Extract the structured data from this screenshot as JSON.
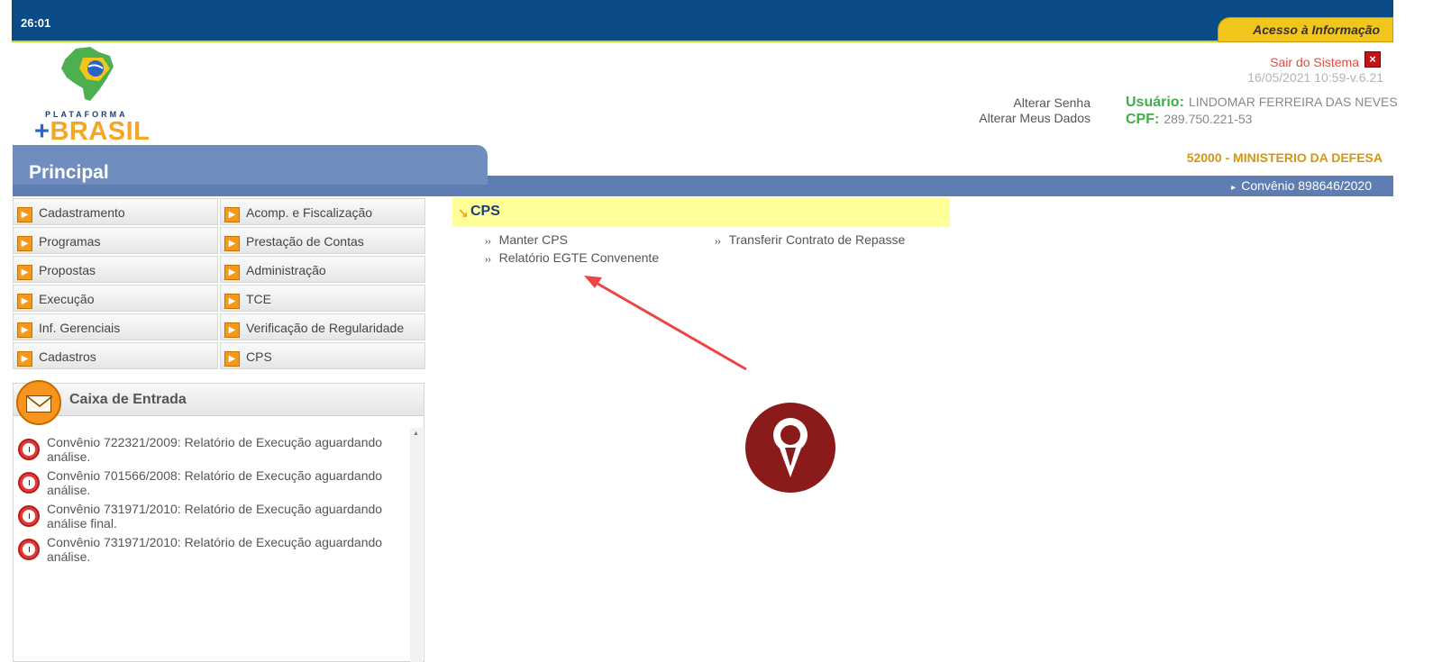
{
  "header": {
    "timer": "26:01",
    "acesso_label": "Acesso à Informação"
  },
  "logo": {
    "top_text": "PLATAFORMA",
    "plus": "+",
    "brand": "BRASIL"
  },
  "user": {
    "sair_label": "Sair do Sistema",
    "close_glyph": "×",
    "timestamp": "16/05/2021 10:59-v.6.21",
    "alterar_senha": "Alterar Senha",
    "alterar_dados": "Alterar Meus Dados",
    "usuario_label": "Usuário:",
    "usuario_value": "LINDOMAR FERREIRA DAS NEVES",
    "cpf_label": "CPF:",
    "cpf_value": "289.750.221-53",
    "orgao": "52000 - MINISTERIO DA DEFESA"
  },
  "principal": {
    "title": "Principal",
    "convenio": "Convênio 898646/2020",
    "convenio_marker": "▸"
  },
  "menu": {
    "items": [
      {
        "label": "Cadastramento"
      },
      {
        "label": "Acomp. e Fiscalização"
      },
      {
        "label": "Programas"
      },
      {
        "label": "Prestação de Contas"
      },
      {
        "label": "Propostas"
      },
      {
        "label": "Administração"
      },
      {
        "label": "Execução"
      },
      {
        "label": "TCE"
      },
      {
        "label": "Inf. Gerenciais"
      },
      {
        "label": "Verificação de Regularidade"
      },
      {
        "label": "Cadastros"
      },
      {
        "label": "CPS"
      }
    ],
    "icon_glyph": "▶"
  },
  "inbox": {
    "title": "Caixa de Entrada",
    "scroll_up": "▲",
    "messages": [
      {
        "text": "Convênio 722321/2009: Relatório de Execução aguardando análise."
      },
      {
        "text": "Convênio 701566/2008: Relatório de Execução aguardando análise."
      },
      {
        "text": "Convênio 731971/2010: Relatório de Execução aguardando análise final."
      },
      {
        "text": "Convênio 731971/2010: Relatório de Execução aguardando análise."
      }
    ]
  },
  "cps": {
    "title": "CPS",
    "arrow": "↘",
    "bullet": "››",
    "links": {
      "manter": "Manter CPS",
      "transferir": "Transferir Contrato de Repasse",
      "relatorio": "Relatório EGTE Convenente"
    }
  },
  "icons": {
    "envelope": "envelope-icon",
    "clock": "clock-icon",
    "menu_arrow": "play-arrow-icon",
    "annotation": "red-arrow",
    "watermark": "chat-logo-badge"
  },
  "colors": {
    "topbar": "#0a4a86",
    "accent_yellow": "#f3c61e",
    "principal_blue": "#5d7db3",
    "menu_icon": "#f39a1b",
    "cps_highlight": "#ffff99",
    "annotation_red": "#ee4444",
    "badge": "#8b1a1a"
  }
}
